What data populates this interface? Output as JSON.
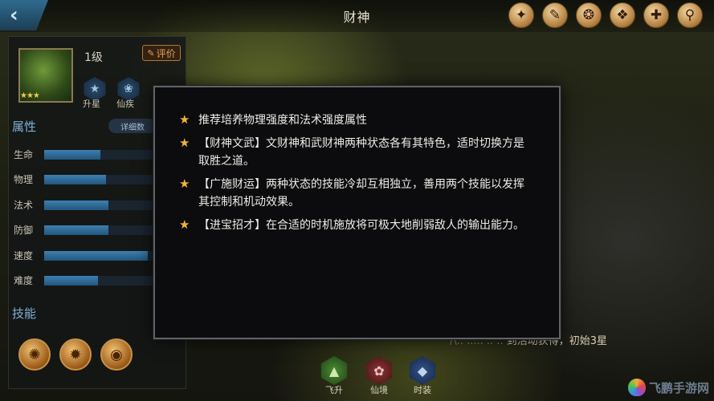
{
  "header": {
    "title": "财神",
    "back_icon": "back-arrow-icon",
    "icons": [
      {
        "name": "scroll-seal-icon",
        "glyph": "✦"
      },
      {
        "name": "scroll-icon",
        "glyph": "✎"
      },
      {
        "name": "coin-icon",
        "glyph": "❂"
      },
      {
        "name": "map-icon",
        "glyph": "❖"
      },
      {
        "name": "book-icon",
        "glyph": "✚"
      },
      {
        "name": "magnifier-icon",
        "glyph": "⚲"
      }
    ]
  },
  "hero": {
    "level": "1级",
    "stars": "★★★",
    "rate_label": "评价",
    "upgrade_label": "升星",
    "fairy_label": "仙疾"
  },
  "attributes": {
    "title": "属性",
    "detail_label": "详细数",
    "items": [
      {
        "label": "生命",
        "value": 0.5
      },
      {
        "label": "物理",
        "value": 0.55
      },
      {
        "label": "法术",
        "value": 0.57
      },
      {
        "label": "防御",
        "value": 0.57
      },
      {
        "label": "速度",
        "value": 0.92
      },
      {
        "label": "难度",
        "value": 0.48
      }
    ]
  },
  "skills": {
    "title": "技能",
    "items": [
      {
        "name": "skill-swirl-icon",
        "glyph": "✺"
      },
      {
        "name": "skill-crab-icon",
        "glyph": "✹"
      },
      {
        "name": "skill-ingot-icon",
        "glyph": "◉"
      }
    ]
  },
  "bottom": {
    "note_prefix": "ㅤ/\\.. ..... .. ..",
    "note_text": "到活动获得，初始3星",
    "tabs": [
      {
        "label": "飞升",
        "glyph": "▲",
        "color": "#3b7a2a"
      },
      {
        "label": "仙境",
        "glyph": "✿",
        "color": "#7a2a2a"
      },
      {
        "label": "时装",
        "glyph": "◆",
        "color": "#2a4a7a"
      }
    ]
  },
  "watermark": {
    "text": "飞鹏手游网"
  },
  "modal": {
    "items": [
      "推荐培养物理强度和法术强度属性",
      "【财神文武】文财神和武财神两种状态各有其特色，适时切换方是取胜之道。",
      "【广施财运】两种状态的技能冷却互相独立，善用两个技能以发挥其控制和机动效果。",
      "【进宝招才】在合适的时机施放将可极大地削弱敌人的输出能力。"
    ]
  },
  "colors": {
    "accent_blue": "#7fb2d8",
    "star_gold": "#f3b43a",
    "bar_blue": "#3d7fb0"
  }
}
